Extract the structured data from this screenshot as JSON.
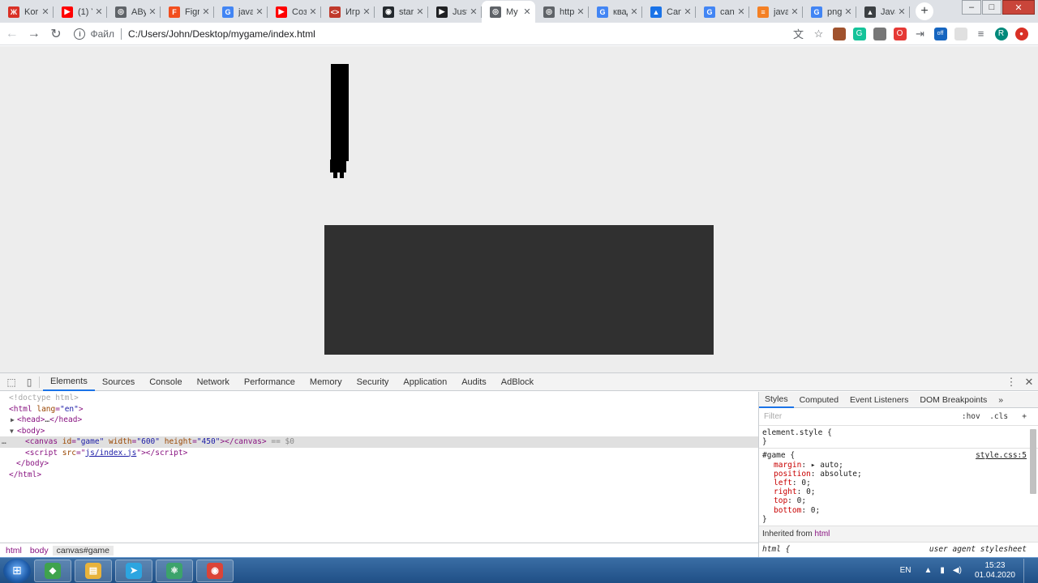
{
  "browser": {
    "tabs": [
      {
        "title": "Kor",
        "color": "#d93025",
        "glyph": "Ж"
      },
      {
        "title": "(1) Y",
        "color": "#ff0000",
        "glyph": "▶"
      },
      {
        "title": "ABy",
        "color": "#5f6368",
        "glyph": "◎"
      },
      {
        "title": "Figr",
        "color": "#f24e1e",
        "glyph": "F"
      },
      {
        "title": "javascri",
        "color": "#4285f4",
        "glyph": "G"
      },
      {
        "title": "Создан",
        "color": "#ff0000",
        "glyph": "▶"
      },
      {
        "title": "Игра на",
        "color": "#c0392b",
        "glyph": "<>"
      },
      {
        "title": "starzon",
        "color": "#24292e",
        "glyph": "◉"
      },
      {
        "title": "Just",
        "color": "#202124",
        "glyph": "▶"
      },
      {
        "title": "My",
        "color": "#5f6368",
        "glyph": "◎",
        "active": true
      },
      {
        "title": "http",
        "color": "#5f6368",
        "glyph": "◎"
      },
      {
        "title": "квадра",
        "color": "#4285f4",
        "glyph": "G"
      },
      {
        "title": "Canvas",
        "color": "#1a73e8",
        "glyph": "▲"
      },
      {
        "title": "canvas",
        "color": "#4285f4",
        "glyph": "G"
      },
      {
        "title": "javascri",
        "color": "#f48024",
        "glyph": "≡"
      },
      {
        "title": "png sm",
        "color": "#4285f4",
        "glyph": "G"
      },
      {
        "title": "Javascri",
        "color": "#3c4043",
        "glyph": "▲"
      }
    ],
    "new_tab": "+",
    "window_controls": {
      "minimize": "‒",
      "maximize": "□",
      "close": "✕"
    },
    "toolbar": {
      "back": "←",
      "forward": "→",
      "reload": "↻",
      "info": "i",
      "scheme": "Файл",
      "url": "C:/Users/John/Desktop/mygame/index.html"
    },
    "extensions": [
      {
        "name": "translate-icon",
        "color": "#5f6368",
        "glyph": "文"
      },
      {
        "name": "star-icon",
        "color": "#5f6368",
        "glyph": "☆"
      },
      {
        "name": "ext-brown-icon",
        "color": "#a0522d",
        "glyph": ""
      },
      {
        "name": "ext-green-icon",
        "color": "#15c39a",
        "glyph": "G"
      },
      {
        "name": "ext-gray-icon",
        "color": "#777777",
        "glyph": ""
      },
      {
        "name": "opera-icon",
        "color": "#e53935",
        "glyph": "O"
      },
      {
        "name": "ext-plug-icon",
        "color": "#5f6368",
        "glyph": "⇥"
      },
      {
        "name": "ext-off-icon",
        "color": "#1565c0",
        "glyph": "off"
      },
      {
        "name": "ext-blank-icon",
        "color": "#e0e0e0",
        "glyph": ""
      },
      {
        "name": "menu-list-icon",
        "color": "#5f6368",
        "glyph": "≡"
      },
      {
        "name": "profile-avatar",
        "color": "#00897b",
        "glyph": "R"
      },
      {
        "name": "update-icon",
        "color": "#d93025",
        "glyph": "●"
      }
    ]
  },
  "devtools": {
    "tabs": [
      "Elements",
      "Sources",
      "Console",
      "Network",
      "Performance",
      "Memory",
      "Security",
      "Application",
      "Audits",
      "AdBlock"
    ],
    "active_tab": "Elements",
    "dom": {
      "doctype": "<!doctype html>",
      "html_open_tag": "html",
      "lang_attr": "lang",
      "lang_val": "\"en\"",
      "head": "head",
      "head_ellipsis": "…",
      "body": "body",
      "canvas_tag": "canvas",
      "id_attr": "id",
      "id_val": "\"game\"",
      "width_attr": "width",
      "width_val": "\"600\"",
      "height_attr": "height",
      "height_val": "\"450\"",
      "eq_dollar": "== $0",
      "script_tag": "script",
      "src_attr": "src",
      "src_val": "js/index.js",
      "body_close": "/body",
      "html_close": "/html",
      "ellipsis_dots": "…"
    },
    "breadcrumbs": [
      "html",
      "body",
      "canvas#game"
    ],
    "styles": {
      "tabs": [
        "Styles",
        "Computed",
        "Event Listeners",
        "DOM Breakpoints"
      ],
      "more": "»",
      "filter_placeholder": "Filter",
      "hov": ":hov",
      "cls": ".cls",
      "add": "+",
      "element_style": "element.style {",
      "close_brace": "}",
      "rule_selector": "#game {",
      "rule_source": "style.css:5",
      "declarations": [
        {
          "prop": "margin",
          "value": "▸ auto;"
        },
        {
          "prop": "position",
          "value": "absolute;"
        },
        {
          "prop": "left",
          "value": "0;"
        },
        {
          "prop": "right",
          "value": "0;"
        },
        {
          "prop": "top",
          "value": "0;"
        },
        {
          "prop": "bottom",
          "value": "0;"
        }
      ],
      "inherited_label": "Inherited from",
      "inherited_from": "html",
      "ua_selector": "html {",
      "ua_source": "user agent stylesheet"
    }
  },
  "taskbar": {
    "apps": [
      {
        "name": "windows-live-icon",
        "color": "#3fa34d",
        "glyph": "◆"
      },
      {
        "name": "explorer-icon",
        "color": "#e8b33b",
        "glyph": "▤"
      },
      {
        "name": "telegram-icon",
        "color": "#2ca5e0",
        "glyph": "➤"
      },
      {
        "name": "atom-icon",
        "color": "#3ca36b",
        "glyph": "⚛"
      },
      {
        "name": "chrome-icon",
        "color": "#db4437",
        "glyph": "◉"
      }
    ],
    "lang": "EN",
    "time": "15:23",
    "date": "01.04.2020"
  }
}
